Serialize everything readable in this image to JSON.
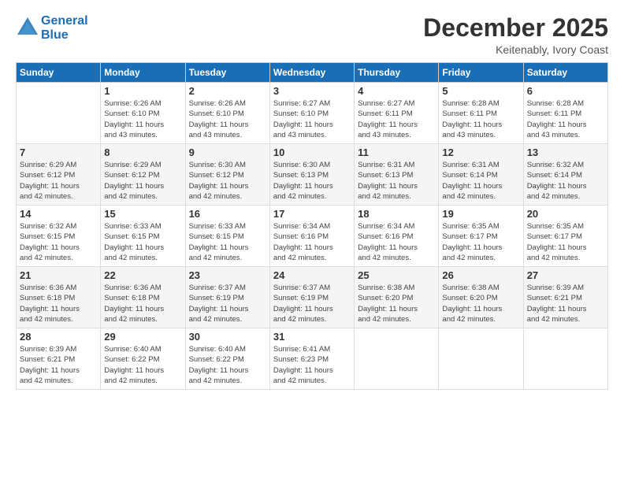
{
  "logo": {
    "line1": "General",
    "line2": "Blue"
  },
  "title": "December 2025",
  "location": "Keitenably, Ivory Coast",
  "days_header": [
    "Sunday",
    "Monday",
    "Tuesday",
    "Wednesday",
    "Thursday",
    "Friday",
    "Saturday"
  ],
  "weeks": [
    [
      {
        "day": "",
        "info": ""
      },
      {
        "day": "1",
        "info": "Sunrise: 6:26 AM\nSunset: 6:10 PM\nDaylight: 11 hours\nand 43 minutes."
      },
      {
        "day": "2",
        "info": "Sunrise: 6:26 AM\nSunset: 6:10 PM\nDaylight: 11 hours\nand 43 minutes."
      },
      {
        "day": "3",
        "info": "Sunrise: 6:27 AM\nSunset: 6:10 PM\nDaylight: 11 hours\nand 43 minutes."
      },
      {
        "day": "4",
        "info": "Sunrise: 6:27 AM\nSunset: 6:11 PM\nDaylight: 11 hours\nand 43 minutes."
      },
      {
        "day": "5",
        "info": "Sunrise: 6:28 AM\nSunset: 6:11 PM\nDaylight: 11 hours\nand 43 minutes."
      },
      {
        "day": "6",
        "info": "Sunrise: 6:28 AM\nSunset: 6:11 PM\nDaylight: 11 hours\nand 43 minutes."
      }
    ],
    [
      {
        "day": "7",
        "info": "Sunrise: 6:29 AM\nSunset: 6:12 PM\nDaylight: 11 hours\nand 42 minutes."
      },
      {
        "day": "8",
        "info": "Sunrise: 6:29 AM\nSunset: 6:12 PM\nDaylight: 11 hours\nand 42 minutes."
      },
      {
        "day": "9",
        "info": "Sunrise: 6:30 AM\nSunset: 6:12 PM\nDaylight: 11 hours\nand 42 minutes."
      },
      {
        "day": "10",
        "info": "Sunrise: 6:30 AM\nSunset: 6:13 PM\nDaylight: 11 hours\nand 42 minutes."
      },
      {
        "day": "11",
        "info": "Sunrise: 6:31 AM\nSunset: 6:13 PM\nDaylight: 11 hours\nand 42 minutes."
      },
      {
        "day": "12",
        "info": "Sunrise: 6:31 AM\nSunset: 6:14 PM\nDaylight: 11 hours\nand 42 minutes."
      },
      {
        "day": "13",
        "info": "Sunrise: 6:32 AM\nSunset: 6:14 PM\nDaylight: 11 hours\nand 42 minutes."
      }
    ],
    [
      {
        "day": "14",
        "info": "Sunrise: 6:32 AM\nSunset: 6:15 PM\nDaylight: 11 hours\nand 42 minutes."
      },
      {
        "day": "15",
        "info": "Sunrise: 6:33 AM\nSunset: 6:15 PM\nDaylight: 11 hours\nand 42 minutes."
      },
      {
        "day": "16",
        "info": "Sunrise: 6:33 AM\nSunset: 6:15 PM\nDaylight: 11 hours\nand 42 minutes."
      },
      {
        "day": "17",
        "info": "Sunrise: 6:34 AM\nSunset: 6:16 PM\nDaylight: 11 hours\nand 42 minutes."
      },
      {
        "day": "18",
        "info": "Sunrise: 6:34 AM\nSunset: 6:16 PM\nDaylight: 11 hours\nand 42 minutes."
      },
      {
        "day": "19",
        "info": "Sunrise: 6:35 AM\nSunset: 6:17 PM\nDaylight: 11 hours\nand 42 minutes."
      },
      {
        "day": "20",
        "info": "Sunrise: 6:35 AM\nSunset: 6:17 PM\nDaylight: 11 hours\nand 42 minutes."
      }
    ],
    [
      {
        "day": "21",
        "info": "Sunrise: 6:36 AM\nSunset: 6:18 PM\nDaylight: 11 hours\nand 42 minutes."
      },
      {
        "day": "22",
        "info": "Sunrise: 6:36 AM\nSunset: 6:18 PM\nDaylight: 11 hours\nand 42 minutes."
      },
      {
        "day": "23",
        "info": "Sunrise: 6:37 AM\nSunset: 6:19 PM\nDaylight: 11 hours\nand 42 minutes."
      },
      {
        "day": "24",
        "info": "Sunrise: 6:37 AM\nSunset: 6:19 PM\nDaylight: 11 hours\nand 42 minutes."
      },
      {
        "day": "25",
        "info": "Sunrise: 6:38 AM\nSunset: 6:20 PM\nDaylight: 11 hours\nand 42 minutes."
      },
      {
        "day": "26",
        "info": "Sunrise: 6:38 AM\nSunset: 6:20 PM\nDaylight: 11 hours\nand 42 minutes."
      },
      {
        "day": "27",
        "info": "Sunrise: 6:39 AM\nSunset: 6:21 PM\nDaylight: 11 hours\nand 42 minutes."
      }
    ],
    [
      {
        "day": "28",
        "info": "Sunrise: 6:39 AM\nSunset: 6:21 PM\nDaylight: 11 hours\nand 42 minutes."
      },
      {
        "day": "29",
        "info": "Sunrise: 6:40 AM\nSunset: 6:22 PM\nDaylight: 11 hours\nand 42 minutes."
      },
      {
        "day": "30",
        "info": "Sunrise: 6:40 AM\nSunset: 6:22 PM\nDaylight: 11 hours\nand 42 minutes."
      },
      {
        "day": "31",
        "info": "Sunrise: 6:41 AM\nSunset: 6:23 PM\nDaylight: 11 hours\nand 42 minutes."
      },
      {
        "day": "",
        "info": ""
      },
      {
        "day": "",
        "info": ""
      },
      {
        "day": "",
        "info": ""
      }
    ]
  ]
}
